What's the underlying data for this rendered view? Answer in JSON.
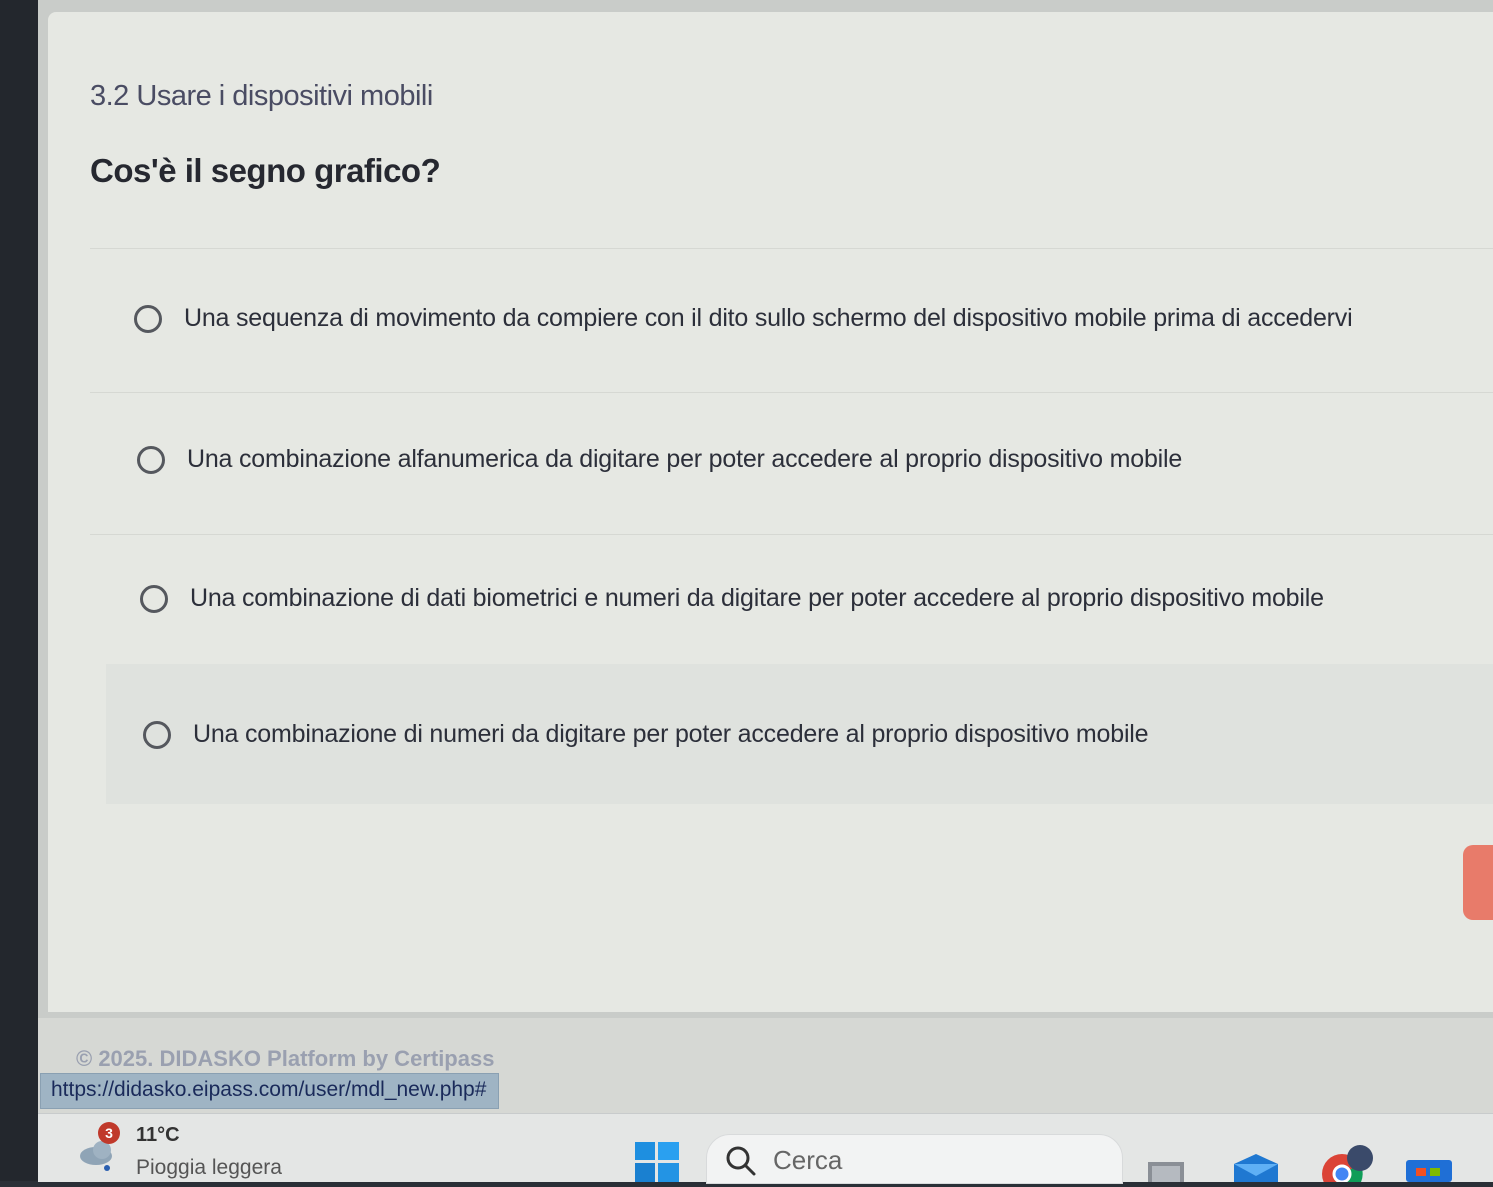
{
  "section_title": "3.2 Usare i dispositivi mobili",
  "question": "Cos'è il segno grafico?",
  "options": [
    {
      "label": "Una sequenza di movimento da compiere con il dito sullo schermo del dispositivo mobile prima di accedervi",
      "selected": false
    },
    {
      "label": "Una combinazione alfanumerica da digitare per poter accedere al proprio dispositivo mobile",
      "selected": false
    },
    {
      "label": "Una combinazione di dati biometrici e numeri da digitare per poter accedere al proprio dispositivo mobile",
      "selected": false
    },
    {
      "label": "Una combinazione di numeri da digitare per poter accedere al proprio dispositivo mobile",
      "selected": false
    }
  ],
  "footer": {
    "copyright": "© 2025. DIDASKO Platform by Certipass",
    "status_url": "https://didasko.eipass.com/user/mdl_new.php#"
  },
  "taskbar": {
    "weather": {
      "badge": "3",
      "temp": "11°C",
      "desc": "Pioggia leggera",
      "icon": "rain-cloud-icon"
    },
    "start_icon": "windows-start-icon",
    "search_placeholder": "Cerca",
    "pinned_icons": [
      "file-explorer-icon",
      "mail-icon",
      "chrome-icon",
      "store-icon"
    ]
  },
  "colors": {
    "accent_button": "#e87b6a",
    "status_bar": "#9fb4c4"
  }
}
